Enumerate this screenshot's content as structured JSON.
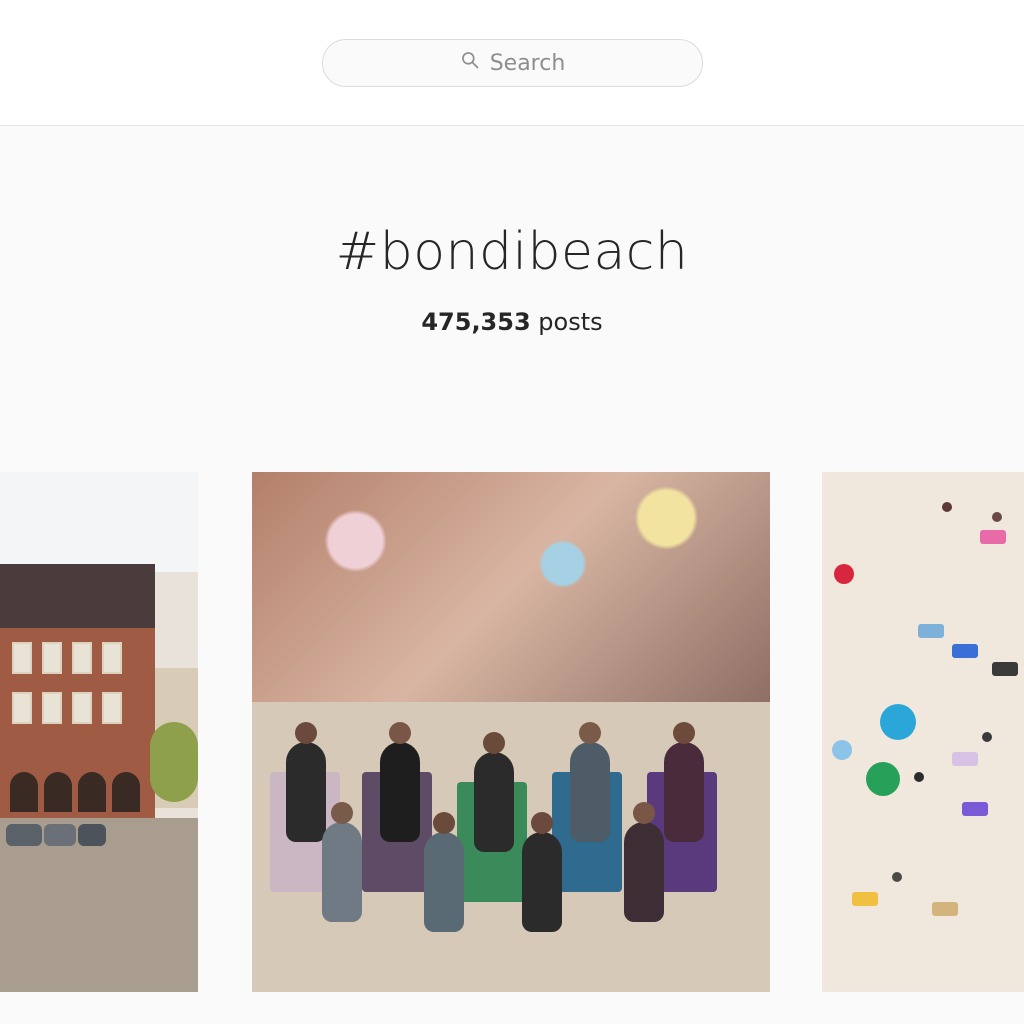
{
  "header": {
    "search": {
      "placeholder": "Search"
    }
  },
  "hashtag": {
    "title": "#bondibeach",
    "posts_count": "475,353",
    "posts_label": "posts"
  },
  "colors": {
    "background": "#fafafa",
    "text": "#262626",
    "muted": "#8e8e8e",
    "border": "#dbdbdb"
  },
  "icons": {
    "search": "search-icon"
  }
}
